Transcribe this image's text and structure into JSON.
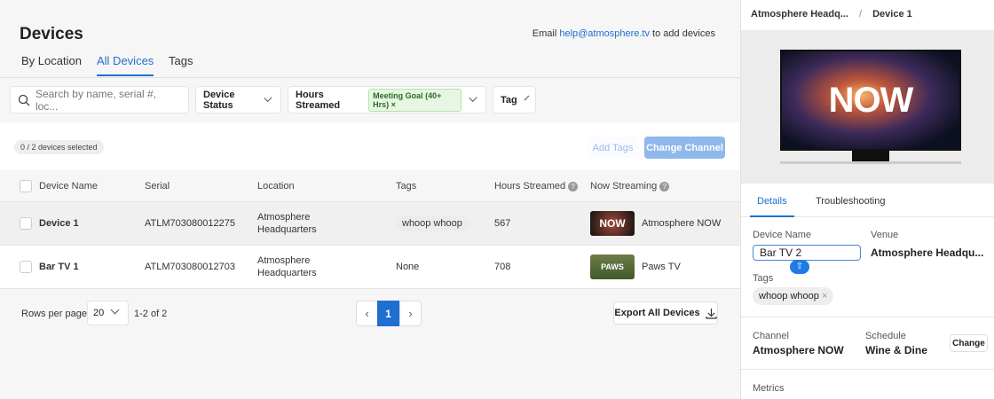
{
  "header": {
    "title": "Devices",
    "email_prefix": "Email ",
    "email": "help@atmosphere.tv",
    "email_suffix": " to add devices"
  },
  "tabs": [
    "By Location",
    "All Devices",
    "Tags"
  ],
  "filters": {
    "search_placeholder": "Search by name, serial #, loc...",
    "device_status": "Device Status",
    "hours_streamed": "Hours Streamed",
    "hours_chip": "Meeting Goal (40+ Hrs)",
    "tag": "Tag"
  },
  "selection": {
    "count": "0 / 2 devices selected",
    "add_tags": "Add Tags",
    "change_channel": "Change Channel"
  },
  "table": {
    "columns": [
      "Device Name",
      "Serial",
      "Location",
      "Tags",
      "Hours Streamed",
      "Now Streaming"
    ],
    "rows": [
      {
        "name": "Device 1",
        "serial": "ATLM703080012275",
        "location1": "Atmosphere",
        "location2": "Headquarters",
        "tags": "whoop whoop",
        "hours": "567",
        "streaming": "Atmosphere NOW",
        "thumb": "NOW"
      },
      {
        "name": "Bar TV 1",
        "serial": "ATLM703080012703",
        "location1": "Atmosphere",
        "location2": "Headquarters",
        "tags": "None",
        "hours": "708",
        "streaming": "Paws TV",
        "thumb": "PAWS"
      }
    ]
  },
  "pagination": {
    "rows_label": "Rows per page",
    "rows_value": "20",
    "range": "1-2 of 2",
    "page": "1",
    "export": "Export All Devices"
  },
  "panel": {
    "crumb_parent": "Atmosphere Headq...",
    "crumb_sep": "/",
    "crumb_current": "Device 1",
    "tv_text": "NOW",
    "tabs": [
      "Details",
      "Troubleshooting"
    ],
    "device_name_label": "Device Name",
    "device_name_value": "Bar TV 2",
    "venue_label": "Venue",
    "venue_value": "Atmosphere Headqu...",
    "tags_label": "Tags",
    "tag": "whoop whoop",
    "channel_label": "Channel",
    "channel_value": "Atmosphere NOW",
    "schedule_label": "Schedule",
    "schedule_value": "Wine & Dine",
    "change": "Change",
    "metrics_label": "Metrics"
  },
  "colors": {
    "accent": "#1f6fd1"
  }
}
